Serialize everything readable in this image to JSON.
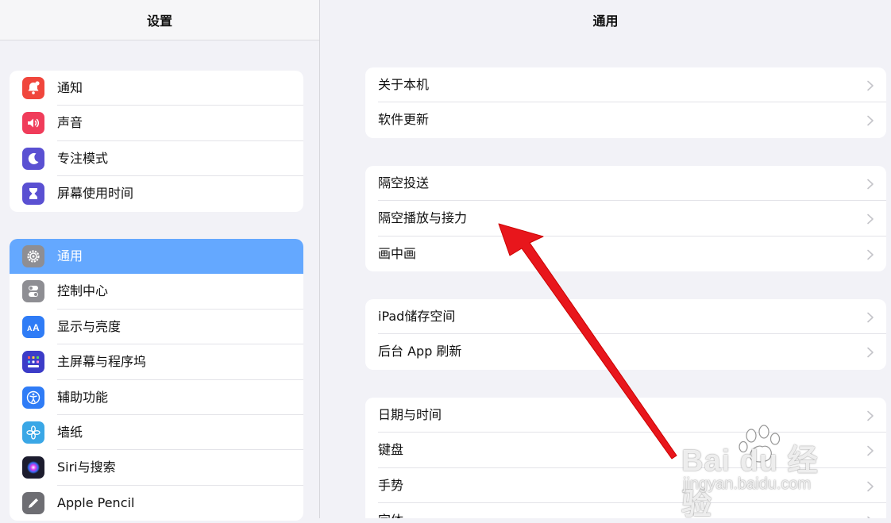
{
  "sidebar": {
    "title": "设置",
    "groups": [
      [
        {
          "label": "通知",
          "icon": "bell-badge-icon",
          "color": "#f0463c"
        },
        {
          "label": "声音",
          "icon": "speaker-icon",
          "color": "#f03c5a"
        },
        {
          "label": "专注模式",
          "icon": "moon-icon",
          "color": "#5a50d2"
        },
        {
          "label": "屏幕使用时间",
          "icon": "hourglass-icon",
          "color": "#5a50d2"
        }
      ],
      [
        {
          "label": "通用",
          "icon": "gear-icon",
          "color": "#8e8e93",
          "selected": true
        },
        {
          "label": "控制中心",
          "icon": "toggles-icon",
          "color": "#8e8e93"
        },
        {
          "label": "显示与亮度",
          "icon": "text-size-icon",
          "color": "#2f7cf6"
        },
        {
          "label": "主屏幕与程序坞",
          "icon": "app-grid-icon",
          "color": "#3c3cc8"
        },
        {
          "label": "辅助功能",
          "icon": "accessibility-icon",
          "color": "#2f7cf6"
        },
        {
          "label": "墙纸",
          "icon": "flower-icon",
          "color": "#3aa7e6"
        },
        {
          "label": "Siri与搜索",
          "icon": "siri-icon",
          "color": "#1c1c2e"
        },
        {
          "label": "Apple Pencil",
          "icon": "pencil-icon",
          "color": "#6e6e73"
        }
      ]
    ]
  },
  "main": {
    "title": "通用",
    "groups": [
      [
        "关于本机",
        "软件更新"
      ],
      [
        "隔空投送",
        "隔空播放与接力",
        "画中画"
      ],
      [
        "iPad储存空间",
        "后台 App 刷新"
      ],
      [
        "日期与时间",
        "键盘",
        "手势",
        "字体"
      ]
    ]
  },
  "annotation": {
    "color": "#e8161c"
  },
  "watermark": {
    "brand": "Bai du 经验",
    "url": "jingyan.baidu.com"
  }
}
